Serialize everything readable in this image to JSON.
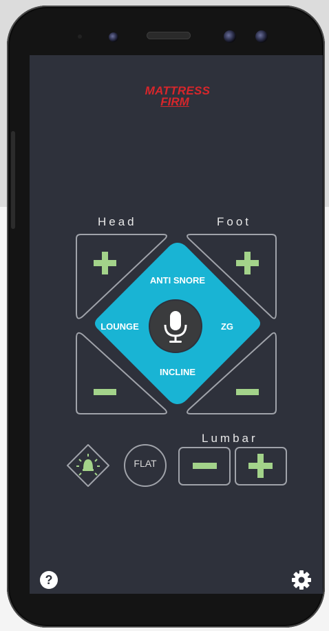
{
  "brand": {
    "line1": "MATTRESS",
    "line2": "FIRM"
  },
  "labels": {
    "head": "Head",
    "foot": "Foot",
    "lumbar": "Lumbar"
  },
  "presets": {
    "anti_snore": "ANTI SNORE",
    "lounge": "LOUNGE",
    "zg": "ZG",
    "incline": "INCLINE",
    "flat": "FLAT"
  },
  "icons": {
    "microphone": "microphone-icon",
    "plus": "plus-icon",
    "minus": "minus-icon",
    "light": "light-icon",
    "help": "help-icon",
    "settings": "gear-icon"
  },
  "help_symbol": "?",
  "colors": {
    "accent_diamond": "#19b4d4",
    "button_green": "#a3d38a",
    "screen_bg": "#2e313b",
    "brand_red": "#d8262b"
  }
}
